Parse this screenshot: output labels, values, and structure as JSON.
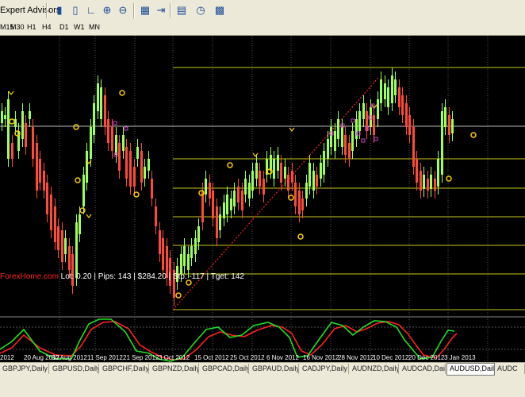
{
  "toolbar": {
    "expert_advisors_label": "Expert Advisors",
    "timeframes": [
      "M15",
      "M30",
      "H1",
      "H4",
      "D1",
      "W1",
      "MN"
    ],
    "icons": [
      "chart-bar-icon",
      "chart-candle-icon",
      "chart-line-icon",
      "zoom-in-icon",
      "zoom-out-icon",
      "tile-icon",
      "autoscroll-icon",
      "indicators-icon",
      "periods-icon",
      "templates-icon"
    ]
  },
  "info": {
    "site": "ForexHome.com",
    "text": " Lot: 0.20 | Pips: 143 | $284.20 | Stp: -117 | Tget: 142"
  },
  "x_axis": {
    "labels": [
      "2012",
      "20 Aug 2012",
      "30 Aug 2012",
      "11 Sep 2012",
      "21 Sep 2012",
      "3 Oct 2012",
      "15 Oct 2012",
      "25 Oct 2012",
      "6 Nov 2012",
      "16 Nov 2012",
      "28 Nov 2012",
      "10 Dec 2012",
      "20 Dec 2012",
      "3 Jan 2013"
    ]
  },
  "tabs": [
    {
      "label": "GBPJPY,Daily",
      "active": false
    },
    {
      "label": "GBPUSD,Daily",
      "active": false
    },
    {
      "label": "GBPCHF,Daily",
      "active": false
    },
    {
      "label": "GBPNZD,Daily",
      "active": false
    },
    {
      "label": "GBPCAD,Daily",
      "active": false
    },
    {
      "label": "GBPAUD,Daily",
      "active": false
    },
    {
      "label": "CADJPY,Daily",
      "active": false
    },
    {
      "label": "AUDNZD,Daily",
      "active": false
    },
    {
      "label": "AUDCAD,Daily",
      "active": false
    },
    {
      "label": "AUDUSD,Daily",
      "active": true
    },
    {
      "label": "AUDC",
      "active": false
    }
  ],
  "colors": {
    "bull": "#9cff5a",
    "bear": "#ff4a3a",
    "levels": "#c8c820",
    "stoch_main": "#20e020",
    "stoch_signal": "#ff2020",
    "trendline": "#ff2020",
    "fractal": "#ffcc00",
    "marker": "#d040d0"
  }
}
